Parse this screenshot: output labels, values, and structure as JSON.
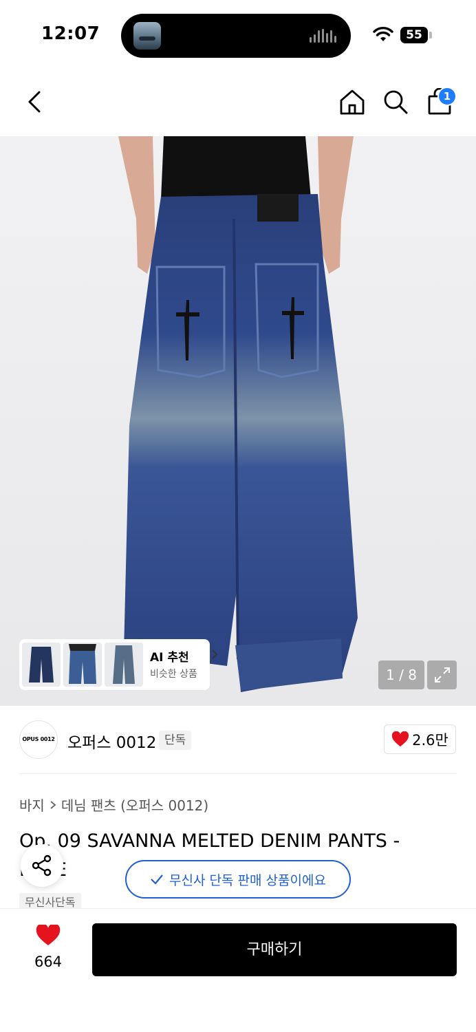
{
  "status_bar": {
    "time": "12:07",
    "battery": "55"
  },
  "nav": {
    "cart_badge": "1"
  },
  "gallery": {
    "ai_title": "AI 추천",
    "ai_subtitle": "비슷한 상품",
    "pager": "1 / 8"
  },
  "brand": {
    "logo_text": "OPUS 0012",
    "name": "오퍼스 0012",
    "badge": "단독",
    "like_count": "2.6만"
  },
  "breadcrumb": {
    "category": "바지",
    "subcategory": "데님 팬츠 (오퍼스 0012)"
  },
  "product": {
    "title": "Op. 09 SAVANNA MELTED DENIM PANTS - BLUE",
    "tag": "무신사단독"
  },
  "toast": {
    "text": "무신사 단독 판매 상품이에요"
  },
  "bottom": {
    "like_count": "664",
    "buy_label": "구매하기"
  },
  "colors": {
    "accent": "#1f5fd6",
    "badge": "#1f7bff",
    "heart": "#e5131d"
  }
}
